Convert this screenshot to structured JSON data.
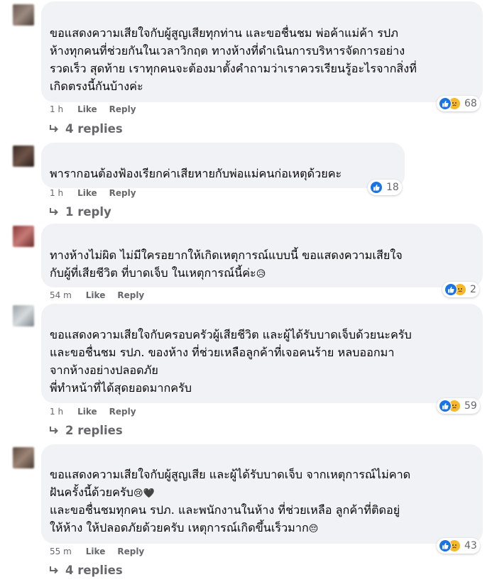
{
  "colors": {
    "bubble": "#f0f2f5",
    "meta_text": "#65676b",
    "like_blue": "#1b74e4",
    "sad_yellow": "#f7b928"
  },
  "actions": {
    "like": "Like",
    "reply": "Reply"
  },
  "comments": [
    {
      "lines": [
        "ขอแสดงความเสียใจกับผู้สูญเสียทุกท่าน และขอชื่นชม พ่อค้าแม่ค้า รปภ",
        "ห้างทุกคนที่ช่วยกันในเวลาวิกฤต ทางห้างที่ดำเนินการบริหารจัดการอย่าง",
        "รวดเร็ว สุดท้าย เราทุกคนจะต้องมาตั้งคำถามว่าเราควรเรียนรู้อะไรจากสิ่งที่",
        "เกิดตรงนี้กันบ้างค่ะ"
      ],
      "time": "1 h",
      "reactions": {
        "icons": [
          "like-icon",
          "sad-icon"
        ],
        "count": "68"
      },
      "replies": "4 replies"
    },
    {
      "lines": [
        "พารากอนต้องฟ้องเรียกค่าเสียหายกับพ่อแม่คนก่อเหตุด้วยคะ"
      ],
      "time": "1 h",
      "reactions": {
        "icons": [
          "like-icon"
        ],
        "count": "18"
      },
      "replies": "1 reply"
    },
    {
      "lines": [
        "ทางห้างไม่ผิด ไม่มีใครอยากให้เกิดเหตุการณ์แบบนี้ ขอแสดงความเสียใจ",
        "กับผู้ที่เสียชีวิต ที่บาดเจ็บ ในเหตุการณ์นี้ค่ะ"
      ],
      "line_emoji": [
        "",
        "😥"
      ],
      "time": "54 m",
      "reactions": {
        "icons": [
          "like-icon",
          "sad-icon"
        ],
        "count": "2"
      },
      "replies": ""
    },
    {
      "lines": [
        "ขอแสดงความเสียใจกับครอบครัวผู้เสียชีวิต และผู้ได้รับบาดเจ็บด้วยนะครับ",
        "และขอชื่นชม รปภ. ของห้าง ที่ช่วยเหลือลูกค้าที่เจอคนร้าย หลบออกมา",
        "จากห้างอย่างปลอดภัย",
        "พี่ทำหน้าที่ได้สุดยอดมากครับ"
      ],
      "time": "1 h",
      "reactions": {
        "icons": [
          "like-icon",
          "sad-icon"
        ],
        "count": "59"
      },
      "replies": "2 replies"
    },
    {
      "lines": [
        "ขอแสดงความเสียใจกับผู้สูญเสีย และผู้ได้รับบาดเจ็บ จากเหตุการณ์ไม่คาด",
        "ฝันครั้งนี้ด้วยครับ",
        "และขอชื่นชมทุกคน รปภ. และพนักงานในห้าง ที่ช่วยเหลือ ลูกค้าที่ติดอยู่",
        "ให้ห้าง ให้ปลอดภัยด้วยครับ เหตุการณ์เกิดขึ้นเร็วมาก"
      ],
      "line_emoji": [
        "",
        "😢🖤",
        "",
        "😔"
      ],
      "time": "55 m",
      "reactions": {
        "icons": [
          "like-icon",
          "sad-icon"
        ],
        "count": "43"
      },
      "replies": "4 replies"
    }
  ]
}
